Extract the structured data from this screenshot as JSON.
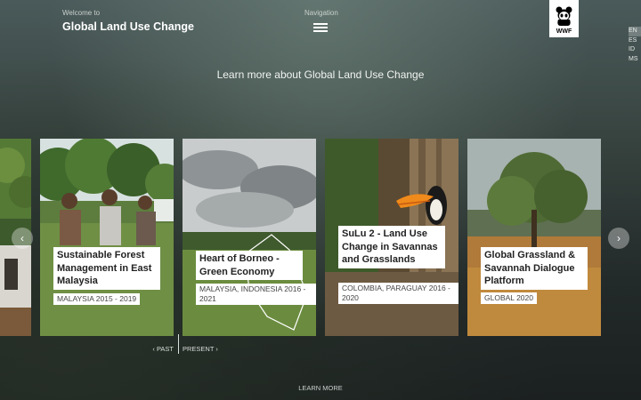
{
  "header": {
    "welcome": "Welcome to",
    "title": "Global Land Use Change",
    "navigation_label": "Navigation",
    "logo_text": "WWF"
  },
  "languages": [
    {
      "code": "EN",
      "active": true
    },
    {
      "code": "ES",
      "active": false
    },
    {
      "code": "ID",
      "active": false
    },
    {
      "code": "MS",
      "active": false
    }
  ],
  "tagline": "Learn more about Global Land Use Change",
  "projects": [
    {
      "title": "Sustainable Forest Management in East Malaysia",
      "meta": "MALAYSIA 2015 - 2019"
    },
    {
      "title": "Heart of Borneo - Green Economy",
      "meta": "MALAYSIA, INDONESIA 2016 - 2021"
    },
    {
      "title": "SuLu 2 - Land Use Change in Savannas and Grasslands",
      "meta": "COLOMBIA, PARAGUAY 2016 - 2020"
    },
    {
      "title": "Global Grassland & Savannah Dialogue Platform",
      "meta": "GLOBAL 2020"
    }
  ],
  "carousel": {
    "prev_icon": "‹",
    "next_icon": "›"
  },
  "timeline": {
    "past": "‹ PAST",
    "present": "PRESENT ›"
  },
  "footer": {
    "learn_more": "LEARN MORE"
  }
}
